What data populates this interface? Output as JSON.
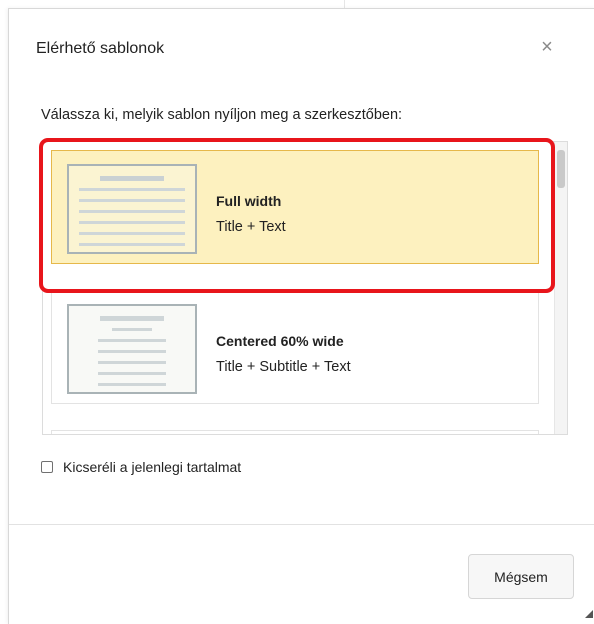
{
  "dialog": {
    "title": "Elérhető sablonok",
    "close_label": "×",
    "instruction": "Válassza ki, melyik sablon nyíljon meg a szerkesztőben:"
  },
  "templates": [
    {
      "name": "Full width",
      "description": "Title + Text",
      "selected": true
    },
    {
      "name": "Centered 60% wide",
      "description": "Title + Subtitle + Text",
      "selected": false
    },
    {
      "name": "",
      "description": "",
      "selected": false
    }
  ],
  "options": {
    "replace_content_label": "Kicseréli a jelenlegi tartalmat",
    "replace_content_checked": false
  },
  "footer": {
    "cancel_label": "Mégsem"
  },
  "colors": {
    "selected_background": "#fdf1bf",
    "selected_border": "#e6b84a",
    "highlight_frame": "#e8151b"
  },
  "icons": {
    "close": "close-icon",
    "resize": "resize-handle-icon",
    "checkbox": "checkbox-icon"
  }
}
